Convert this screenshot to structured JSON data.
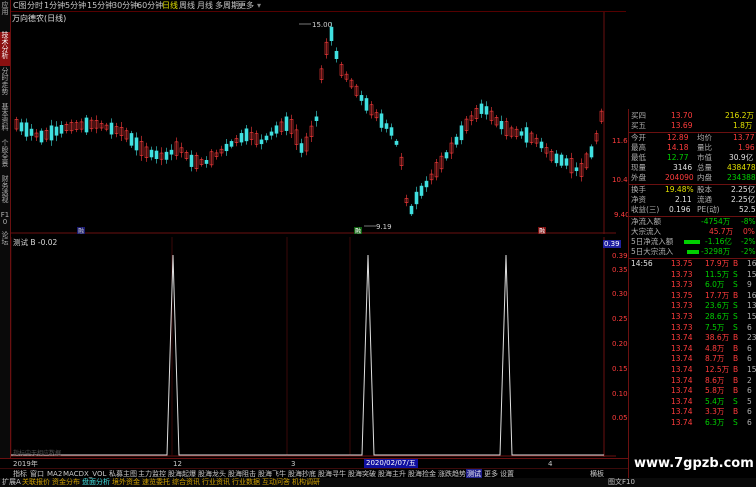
{
  "left_tabs": [
    "应用",
    "技术分析",
    "分时走势",
    "基本资料",
    "个股全景",
    "财务透视",
    "F10",
    "论坛"
  ],
  "period_bar": {
    "tabs": [
      "C图",
      "分时",
      "1分钟",
      "5分钟",
      "15分钟",
      "30分钟",
      "60分钟",
      "日线",
      "周线",
      "月线",
      "多周期",
      "更多"
    ],
    "active": "日线"
  },
  "chart_title": "万向德农(日线)",
  "kline": {
    "high_label": "15.00",
    "low_label": "9.19",
    "y_ticks": [
      "11.60",
      "10.44",
      "9.40"
    ],
    "markers": [
      "融",
      "融",
      "融"
    ]
  },
  "indicator": {
    "title": "测试  B  -0.02",
    "value_tag": "0.39",
    "y_ticks": [
      "0.39",
      "0.35",
      "0.30",
      "0.25",
      "0.20",
      "0.15",
      "0.10",
      "0.05"
    ],
    "watermark_text": "指标中无相应数据"
  },
  "x_axis": [
    "2019年",
    "12",
    "3",
    "4"
  ],
  "date_cursor": "2020/02/07/五",
  "bottom_tabs": [
    "指标",
    "窗口",
    "MA2",
    "MACD",
    "X_VOL",
    "私募主图",
    "主力监控",
    "股海起爆",
    "股海龙头",
    "股海阻击",
    "股海飞牛",
    "股海抄底",
    "股海寻牛",
    "股海突破",
    "股海主升",
    "股海捡金",
    "涨跌趋势",
    "测试",
    "更多",
    "设置"
  ],
  "bottom_active": "测试",
  "status_bar": [
    "关联报价",
    "资金分布",
    "盘面分析",
    "境外资金",
    "速览委托",
    "综合资讯",
    "行业资讯",
    "行业数据",
    "互动问答",
    "机构调研",
    "图文F10"
  ],
  "status_left": "扩展A",
  "mode_tab": "横板",
  "quote_panel": {
    "asks": [
      {
        "label": "买四",
        "price": "13.70",
        "vol": "216.2万"
      },
      {
        "label": "买五",
        "price": "13.69",
        "vol": "1.8万"
      }
    ],
    "stats": [
      {
        "l": "今开",
        "v": "12.89",
        "l2": "均价",
        "v2": "13.77"
      },
      {
        "l": "最高",
        "v": "14.18",
        "l2": "量比",
        "v2": "1.96"
      },
      {
        "l": "最低",
        "v": "12.77",
        "l2": "市值",
        "v2": "30.9亿"
      },
      {
        "l": "现量",
        "v": "3146",
        "l2": "总量",
        "v2": "438478"
      },
      {
        "l": "外盘",
        "v": "204090",
        "l2": "内盘",
        "v2": "234388"
      }
    ],
    "stats2": [
      {
        "l": "换手",
        "v": "19.48%",
        "l2": "股本",
        "v2": "2.25亿"
      },
      {
        "l": "净资",
        "v": "2.11",
        "l2": "流通",
        "v2": "2.25亿"
      },
      {
        "l": "收益(三)",
        "v": "0.196",
        "l2": "PE(动)",
        "v2": "52.5"
      }
    ],
    "flows": [
      {
        "l": "净流入额",
        "v": "-4754万",
        "p": "-8%"
      },
      {
        "l": "大宗流入",
        "v": "45.7万",
        "p": "0%"
      },
      {
        "l": "5日净流入额",
        "v": "-1.16亿",
        "p": "-2%"
      },
      {
        "l": "5日大宗流入",
        "v": "-3298万",
        "p": "-2%"
      }
    ],
    "ticks": [
      {
        "t": "14:56",
        "p": "13.75",
        "v": "17.9万",
        "s": "B",
        "n": "16"
      },
      {
        "t": "",
        "p": "13.73",
        "v": "11.5万",
        "s": "S",
        "n": "15"
      },
      {
        "t": "",
        "p": "13.73",
        "v": "6.0万",
        "s": "S",
        "n": "9"
      },
      {
        "t": "",
        "p": "13.75",
        "v": "17.7万",
        "s": "B",
        "n": "16"
      },
      {
        "t": "",
        "p": "13.73",
        "v": "23.6万",
        "s": "S",
        "n": "13"
      },
      {
        "t": "",
        "p": "13.73",
        "v": "28.6万",
        "s": "S",
        "n": "15"
      },
      {
        "t": "",
        "p": "13.73",
        "v": "7.5万",
        "s": "S",
        "n": "6"
      },
      {
        "t": "",
        "p": "13.74",
        "v": "38.6万",
        "s": "B",
        "n": "23"
      },
      {
        "t": "",
        "p": "13.74",
        "v": "4.8万",
        "s": "B",
        "n": "6"
      },
      {
        "t": "",
        "p": "13.74",
        "v": "8.7万",
        "s": "B",
        "n": "6"
      },
      {
        "t": "",
        "p": "13.74",
        "v": "12.5万",
        "s": "B",
        "n": "15"
      },
      {
        "t": "",
        "p": "13.74",
        "v": "8.6万",
        "s": "B",
        "n": "2"
      },
      {
        "t": "",
        "p": "13.74",
        "v": "5.8万",
        "s": "B",
        "n": "6"
      },
      {
        "t": "",
        "p": "13.74",
        "v": "5.4万",
        "s": "S",
        "n": "5"
      },
      {
        "t": "",
        "p": "13.74",
        "v": "3.3万",
        "s": "B",
        "n": "6"
      },
      {
        "t": "",
        "p": "13.74",
        "v": "6.3万",
        "s": "S",
        "n": "6"
      }
    ]
  },
  "site_watermark": "www.7gpzb.com",
  "colors": {
    "up": "#ff3c3c",
    "down": "#40e0e0",
    "frame": "#8a1010",
    "accent": "#e0e000"
  }
}
